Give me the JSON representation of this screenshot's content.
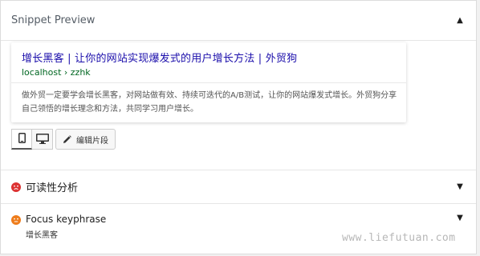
{
  "snippet_preview": {
    "title": "Snippet Preview",
    "toggle_icon": "triangle-up",
    "serp": {
      "title": "增长黑客 | 让你的网站实现爆发式的用户增长方法 | 外贸狗",
      "url": "localhost › zzhk",
      "description": "做外贸一定要学会增长黑客，对网站做有效、持续可迭代的A/B测试，让你的网站爆发式增长。外贸狗分享自己领悟的增长理念和方法，共同学习用户增长。"
    },
    "edit_button_label": "编辑片段"
  },
  "readability": {
    "title": "可读性分析",
    "status_color": "#dc3232",
    "toggle_icon": "triangle-down"
  },
  "focus_keyphrase": {
    "title": "Focus keyphrase",
    "value": "增长黑客",
    "status_color": "#ee7c1b",
    "toggle_icon": "triangle-down"
  },
  "watermark": "www.liefutuan.com",
  "colors": {
    "link": "#1a0dab",
    "url": "#006621",
    "bad": "#dc3232",
    "ok": "#ee7c1b"
  }
}
